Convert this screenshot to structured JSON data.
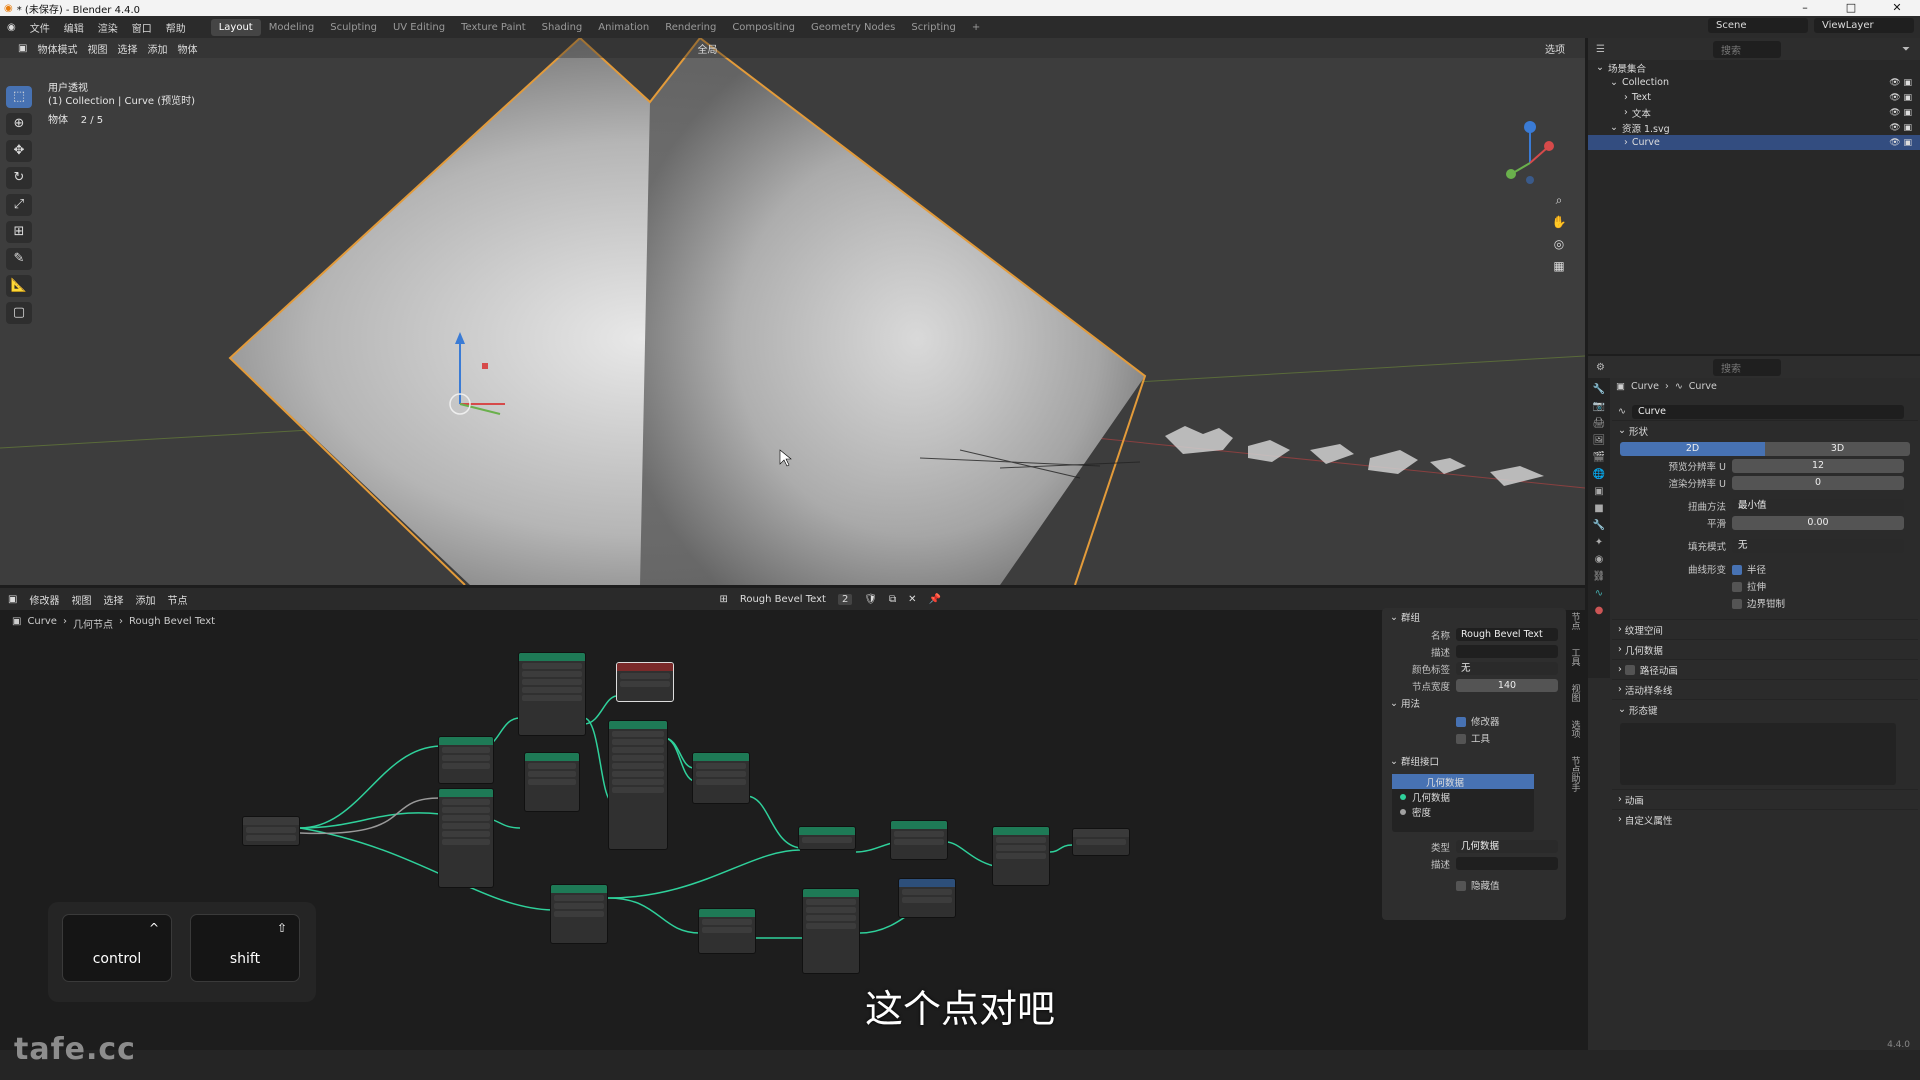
{
  "window": {
    "title": "* (未保存) - Blender 4.4.0"
  },
  "menu": [
    "文件",
    "编辑",
    "渲染",
    "窗口",
    "帮助"
  ],
  "workspaces": [
    "Layout",
    "Modeling",
    "Sculpting",
    "UV Editing",
    "Texture Paint",
    "Shading",
    "Animation",
    "Rendering",
    "Compositing",
    "Geometry Nodes",
    "Scripting"
  ],
  "active_workspace": "Layout",
  "scene": {
    "scene_name": "Scene",
    "view_layer": "ViewLayer"
  },
  "viewport": {
    "mode": "物体模式",
    "menus": [
      "视图",
      "选择",
      "添加",
      "物体"
    ],
    "transform_orientation": "全局",
    "options_label": "选项",
    "view_name": "用户透视",
    "context_line": "(1) Collection | Curve (预览时)",
    "stat_label": "物体",
    "stat_value": "2 / 5"
  },
  "outliner": {
    "search_placeholder": "搜索",
    "rows": [
      {
        "label": "场景集合",
        "indent": 0
      },
      {
        "label": "Collection",
        "indent": 1
      },
      {
        "label": "Text",
        "indent": 2
      },
      {
        "label": "文本",
        "indent": 2
      },
      {
        "label": "资源 1.svg",
        "indent": 1
      },
      {
        "label": "Curve",
        "indent": 2,
        "selected": true
      }
    ]
  },
  "properties": {
    "search_placeholder": "搜索",
    "breadcrumb": [
      "Curve",
      "Curve"
    ],
    "datablock": "Curve",
    "shape_section": "形状",
    "dim_2d": "2D",
    "dim_3d": "3D",
    "fields": [
      {
        "label": "预览分辨率 U",
        "value": "12"
      },
      {
        "label": "渲染分辨率 U",
        "value": "0"
      }
    ],
    "twist_label": "扭曲方法",
    "twist_value": "最小值",
    "smooth_label": "平滑",
    "smooth_value": "0.00",
    "fill_label": "填充模式",
    "fill_value": "无",
    "deform_label": "曲线形变",
    "deform_checks": [
      {
        "label": "半径",
        "on": true
      },
      {
        "label": "拉伸",
        "on": false
      },
      {
        "label": "边界钳制",
        "on": false
      }
    ],
    "sections": [
      "纹理空间",
      "几何数据",
      "路径动画",
      "活动样条线",
      "形态键"
    ],
    "sections_bottom": [
      "动画",
      "自定义属性"
    ]
  },
  "node_editor": {
    "type_label": "修改器",
    "menus": [
      "视图",
      "选择",
      "添加",
      "节点"
    ],
    "node_group": "Rough Bevel Text",
    "users": "2",
    "breadcrumb": [
      "Curve",
      "几何节点",
      "Rough Bevel Text"
    ],
    "vtabs": [
      "节点",
      "工具",
      "视图",
      "选项",
      "节点助手"
    ]
  },
  "group_panel": {
    "head": "群组",
    "name_label": "名称",
    "name_value": "Rough Bevel Text",
    "desc_label": "描述",
    "color_label": "颜色标签",
    "color_value": "无",
    "width_label": "节点宽度",
    "width_value": "140",
    "usage_head": "用法",
    "usage_modifier": "修改器",
    "usage_tool": "工具",
    "interface_head": "群组接口",
    "interface_items": [
      "几何数据",
      "几何数据",
      "密度"
    ],
    "type_label": "类型",
    "type_value": "几何数据",
    "desc2_label": "描述",
    "hide_value": "隐藏值"
  },
  "keys": {
    "key1": "control",
    "key1_sym": "^",
    "key2": "shift",
    "key2_sym": "⇧"
  },
  "subtitle": "这个点对吧",
  "watermark": "tafe.cc",
  "version": "4.4.0",
  "colors": {
    "accent": "#4772b3",
    "node_geo": "#1e7a56",
    "link": "#2fd19b",
    "selection": "#e39b3a"
  }
}
